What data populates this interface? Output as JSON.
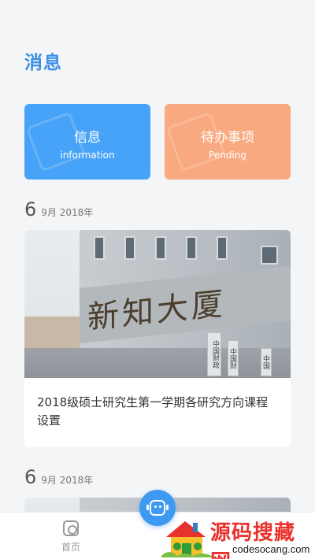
{
  "header": {
    "title": "消息"
  },
  "categories": [
    {
      "cn": "信息",
      "en": "information",
      "color": "#47a3f7"
    },
    {
      "cn": "待办事项",
      "en": "Pending",
      "color": "#f9a97f"
    }
  ],
  "feed": [
    {
      "day": "6",
      "month_year": "9月 2018年",
      "image_sign": "新知大厦",
      "image_plaques": [
        "中国财政",
        "中国财",
        "中国"
      ],
      "title": "2018级硕士研究生第一学期各研究方向课程设置"
    },
    {
      "day": "6",
      "month_year": "9月 2018年"
    }
  ],
  "tabbar": {
    "home_label": "首页",
    "home_icon": "instagram-like-icon",
    "center_icon": "robot-face-icon"
  },
  "watermark": {
    "text": "源码搜藏网",
    "sub": "codesocang.com"
  },
  "colors": {
    "accent": "#3a8ee6",
    "info": "#47a3f7",
    "pending": "#f9a97f"
  }
}
